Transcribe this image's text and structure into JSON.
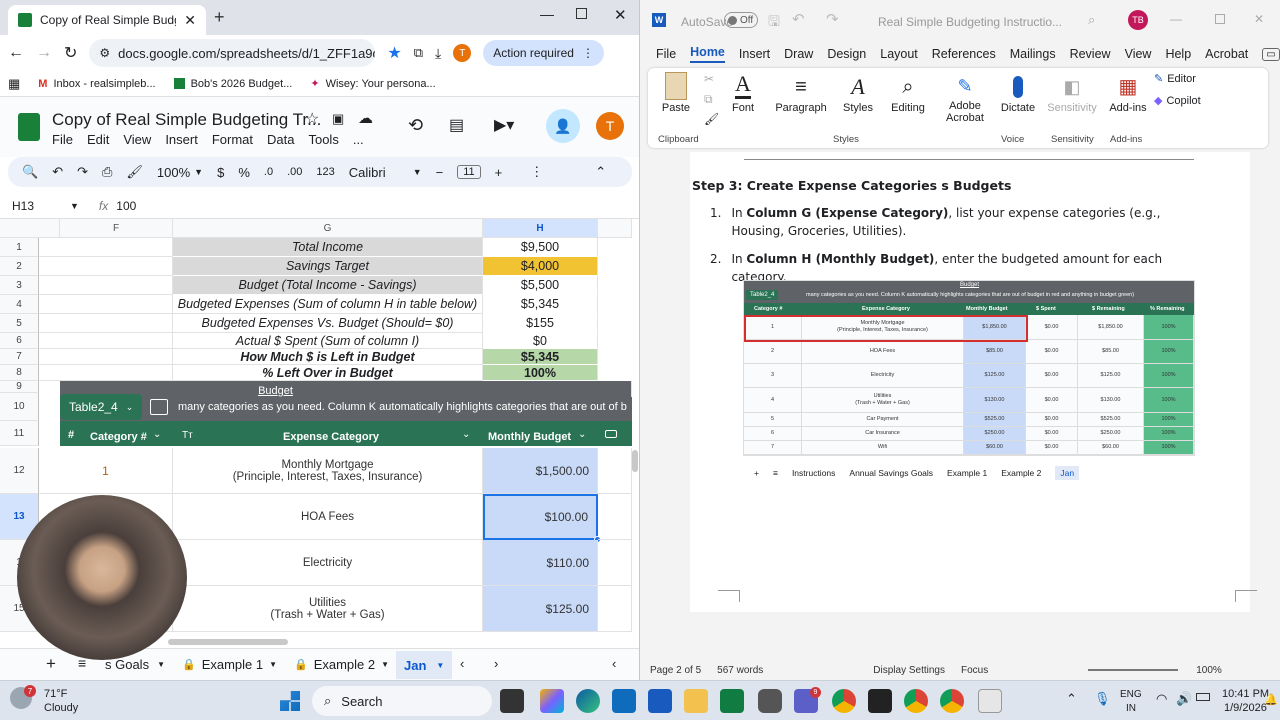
{
  "chrome": {
    "tab_title": "Copy of Real Simple Budgeting",
    "url": "docs.google.com/spreadsheets/d/1_ZFF1a9da...",
    "profile_letter": "T",
    "action_required": "Action required",
    "bookmarks": [
      "Inbox - realsimpleb...",
      "Bob's 2026 Budget...",
      "Wisey: Your persona..."
    ]
  },
  "sheets": {
    "title": "Copy of Real Simple Budgeting Tr...",
    "menus": [
      "File",
      "Edit",
      "View",
      "Insert",
      "Format",
      "Data",
      "Tools",
      "..."
    ],
    "account_letter": "T",
    "toolbar": {
      "zoom": "100%",
      "currency": "$",
      "percent": "%",
      "dec_down": ".0",
      "dec_up": ".00",
      "number_format": "123",
      "font": "Calibri",
      "font_size": "11"
    },
    "name_box": "H13",
    "formula_value": "100",
    "col_headers": {
      "f": "F",
      "g": "G",
      "h": "H"
    },
    "summary_rows": [
      {
        "row": "1",
        "label": "Total Income",
        "value": "$9,500"
      },
      {
        "row": "2",
        "label": "Savings Target",
        "value": "$4,000"
      },
      {
        "row": "3",
        "label": "Budget (Total Income - Savings)",
        "value": "$5,500"
      },
      {
        "row": "4",
        "label": "Budgeted Expenses (Sum of column H in table below)",
        "value": "$5,345"
      },
      {
        "row": "5",
        "label": "Budgeted Expenses Vs. Budget (Should= $0)",
        "value": "$155"
      },
      {
        "row": "6",
        "label": "Actual $ Spent (Sum of column I)",
        "value": "$0"
      },
      {
        "row": "7",
        "label": "How Much $ is Left in Budget",
        "value": "$5,345"
      },
      {
        "row": "8",
        "label": "% Left Over in Budget",
        "value": "100%"
      }
    ],
    "row9": "9",
    "row10": "10",
    "row11": "11",
    "budget_link": "Budget",
    "table_name": "Table2_4",
    "banner": "many categories as you need. Column K automatically highlights categories that are out of b",
    "table_headers": {
      "num": "#",
      "category_num": "Category #",
      "tt": "Tт",
      "expense_category": "Expense Category",
      "monthly_budget": "Monthly Budget"
    },
    "data_rows": [
      {
        "row": "12",
        "num": "1",
        "category_line1": "Monthly Mortgage",
        "category_line2": "(Principle, Interest, Taxes, Insurance)",
        "budget": "$1,500.00"
      },
      {
        "row": "13",
        "num": "",
        "category_line1": "HOA Fees",
        "category_line2": "",
        "budget": "$100.00"
      },
      {
        "row": "1",
        "num": "",
        "category_line1": "Electricity",
        "category_line2": "",
        "budget": "$110.00"
      },
      {
        "row": "15",
        "num": "",
        "category_line1": "Utilities",
        "category_line2": "(Trash + Water + Gas)",
        "budget": "$125.00"
      }
    ],
    "sheet_tabs": [
      "s Goals",
      "Example 1",
      "Example 2",
      "Jan"
    ]
  },
  "word": {
    "autosave": "AutoSave",
    "autosave_state": "Off",
    "doc_title": "Real Simple Budgeting Instructio...",
    "user_initials": "TB",
    "menus": [
      "File",
      "Home",
      "Insert",
      "Draw",
      "Design",
      "Layout",
      "References",
      "Mailings",
      "Review",
      "View",
      "Help",
      "Acrobat"
    ],
    "ribbon": {
      "paste": "Paste",
      "font": "Font",
      "paragraph": "Paragraph",
      "styles": "Styles",
      "editing": "Editing",
      "adobe": "Adobe Acrobat",
      "dictate": "Dictate",
      "sensitivity": "Sensitivity",
      "addins": "Add-ins",
      "editor": "Editor",
      "copilot": "Copilot",
      "groups": {
        "clipboard": "Clipboard",
        "styles": "Styles",
        "voice": "Voice",
        "sensitivity": "Sensitivity",
        "addins": "Add-ins"
      }
    },
    "heading": "Step 3: Create Expense Categories s Budgets",
    "list": [
      {
        "num": "1.",
        "pre": "In ",
        "bold": "Column G (Expense Category)",
        "post": ", list your expense categories (e.g., Housing, Groceries, Utilities)."
      },
      {
        "num": "2.",
        "pre": "In ",
        "bold": "Column H (Monthly Budget)",
        "post": ", enter the budgeted amount for each category."
      }
    ],
    "pic": {
      "budget": "Budget",
      "table_name": "Table2_4",
      "banner": "many categories as you need. Column K automatically highlights categories that are out of budget in red and anything in budget green)",
      "headers": [
        "Category #",
        "Expense Category",
        "Monthly Budget",
        "$ Spent",
        "$ Remaining",
        "% Remaining"
      ],
      "rows": [
        {
          "n": "1",
          "cat": "Monthly Mortgage",
          "sub": "(Principle, Interest, Taxes, Insurance)",
          "b": "$1,850.00",
          "s": "$0.00",
          "r": "$1,850.00",
          "p": "100%"
        },
        {
          "n": "2",
          "cat": "HOA Fees",
          "sub": "",
          "b": "$85.00",
          "s": "$0.00",
          "r": "$85.00",
          "p": "100%"
        },
        {
          "n": "3",
          "cat": "Electricity",
          "sub": "",
          "b": "$125.00",
          "s": "$0.00",
          "r": "$125.00",
          "p": "100%"
        },
        {
          "n": "4",
          "cat": "Utilities",
          "sub": "(Trash + Water + Gas)",
          "b": "$130.00",
          "s": "$0.00",
          "r": "$130.00",
          "p": "100%"
        },
        {
          "n": "5",
          "cat": "Car Payment",
          "sub": "",
          "b": "$525.00",
          "s": "$0.00",
          "r": "$525.00",
          "p": "100%"
        },
        {
          "n": "6",
          "cat": "Car Insurance",
          "sub": "",
          "b": "$250.00",
          "s": "$0.00",
          "r": "$250.00",
          "p": "100%"
        },
        {
          "n": "7",
          "cat": "Wifi",
          "sub": "",
          "b": "$60.00",
          "s": "$0.00",
          "r": "$60.00",
          "p": "100%"
        }
      ],
      "tabs": [
        "Instructions",
        "Annual Savings Goals",
        "Example 1",
        "Example 2",
        "Jan"
      ]
    },
    "status": {
      "page": "Page 2 of 5",
      "words": "567 words",
      "display": "Display Settings",
      "focus": "Focus",
      "zoom": "100%"
    }
  },
  "taskbar": {
    "temp": "71°F",
    "weather": "Cloudy",
    "weather_badge": "7",
    "search": "Search",
    "lang1": "ENG",
    "lang2": "IN",
    "time": "10:41 PM",
    "date": "1/9/2026",
    "teams_badge": "9"
  }
}
